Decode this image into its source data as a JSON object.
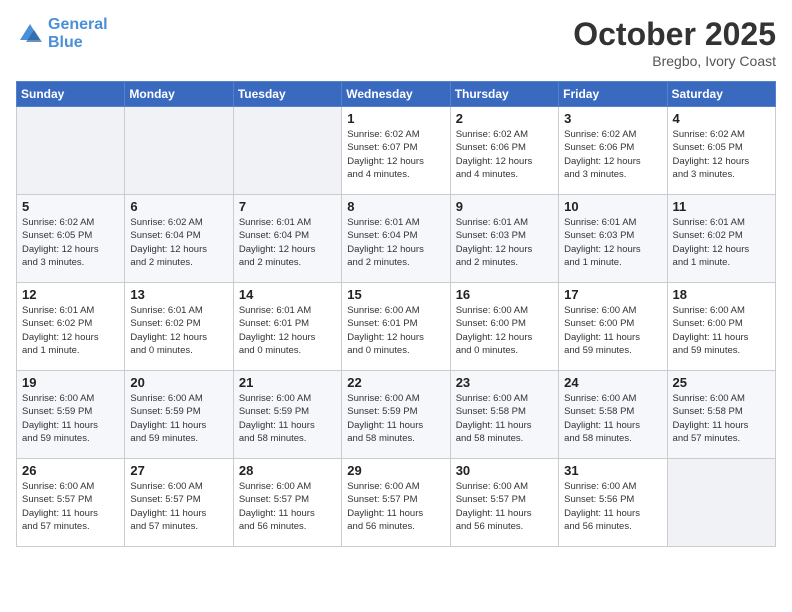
{
  "header": {
    "logo_line1": "General",
    "logo_line2": "Blue",
    "month": "October 2025",
    "location": "Bregbo, Ivory Coast"
  },
  "weekdays": [
    "Sunday",
    "Monday",
    "Tuesday",
    "Wednesday",
    "Thursday",
    "Friday",
    "Saturday"
  ],
  "weeks": [
    [
      {
        "day": "",
        "info": ""
      },
      {
        "day": "",
        "info": ""
      },
      {
        "day": "",
        "info": ""
      },
      {
        "day": "1",
        "info": "Sunrise: 6:02 AM\nSunset: 6:07 PM\nDaylight: 12 hours\nand 4 minutes."
      },
      {
        "day": "2",
        "info": "Sunrise: 6:02 AM\nSunset: 6:06 PM\nDaylight: 12 hours\nand 4 minutes."
      },
      {
        "day": "3",
        "info": "Sunrise: 6:02 AM\nSunset: 6:06 PM\nDaylight: 12 hours\nand 3 minutes."
      },
      {
        "day": "4",
        "info": "Sunrise: 6:02 AM\nSunset: 6:05 PM\nDaylight: 12 hours\nand 3 minutes."
      }
    ],
    [
      {
        "day": "5",
        "info": "Sunrise: 6:02 AM\nSunset: 6:05 PM\nDaylight: 12 hours\nand 3 minutes."
      },
      {
        "day": "6",
        "info": "Sunrise: 6:02 AM\nSunset: 6:04 PM\nDaylight: 12 hours\nand 2 minutes."
      },
      {
        "day": "7",
        "info": "Sunrise: 6:01 AM\nSunset: 6:04 PM\nDaylight: 12 hours\nand 2 minutes."
      },
      {
        "day": "8",
        "info": "Sunrise: 6:01 AM\nSunset: 6:04 PM\nDaylight: 12 hours\nand 2 minutes."
      },
      {
        "day": "9",
        "info": "Sunrise: 6:01 AM\nSunset: 6:03 PM\nDaylight: 12 hours\nand 2 minutes."
      },
      {
        "day": "10",
        "info": "Sunrise: 6:01 AM\nSunset: 6:03 PM\nDaylight: 12 hours\nand 1 minute."
      },
      {
        "day": "11",
        "info": "Sunrise: 6:01 AM\nSunset: 6:02 PM\nDaylight: 12 hours\nand 1 minute."
      }
    ],
    [
      {
        "day": "12",
        "info": "Sunrise: 6:01 AM\nSunset: 6:02 PM\nDaylight: 12 hours\nand 1 minute."
      },
      {
        "day": "13",
        "info": "Sunrise: 6:01 AM\nSunset: 6:02 PM\nDaylight: 12 hours\nand 0 minutes."
      },
      {
        "day": "14",
        "info": "Sunrise: 6:01 AM\nSunset: 6:01 PM\nDaylight: 12 hours\nand 0 minutes."
      },
      {
        "day": "15",
        "info": "Sunrise: 6:00 AM\nSunset: 6:01 PM\nDaylight: 12 hours\nand 0 minutes."
      },
      {
        "day": "16",
        "info": "Sunrise: 6:00 AM\nSunset: 6:00 PM\nDaylight: 12 hours\nand 0 minutes."
      },
      {
        "day": "17",
        "info": "Sunrise: 6:00 AM\nSunset: 6:00 PM\nDaylight: 11 hours\nand 59 minutes."
      },
      {
        "day": "18",
        "info": "Sunrise: 6:00 AM\nSunset: 6:00 PM\nDaylight: 11 hours\nand 59 minutes."
      }
    ],
    [
      {
        "day": "19",
        "info": "Sunrise: 6:00 AM\nSunset: 5:59 PM\nDaylight: 11 hours\nand 59 minutes."
      },
      {
        "day": "20",
        "info": "Sunrise: 6:00 AM\nSunset: 5:59 PM\nDaylight: 11 hours\nand 59 minutes."
      },
      {
        "day": "21",
        "info": "Sunrise: 6:00 AM\nSunset: 5:59 PM\nDaylight: 11 hours\nand 58 minutes."
      },
      {
        "day": "22",
        "info": "Sunrise: 6:00 AM\nSunset: 5:59 PM\nDaylight: 11 hours\nand 58 minutes."
      },
      {
        "day": "23",
        "info": "Sunrise: 6:00 AM\nSunset: 5:58 PM\nDaylight: 11 hours\nand 58 minutes."
      },
      {
        "day": "24",
        "info": "Sunrise: 6:00 AM\nSunset: 5:58 PM\nDaylight: 11 hours\nand 58 minutes."
      },
      {
        "day": "25",
        "info": "Sunrise: 6:00 AM\nSunset: 5:58 PM\nDaylight: 11 hours\nand 57 minutes."
      }
    ],
    [
      {
        "day": "26",
        "info": "Sunrise: 6:00 AM\nSunset: 5:57 PM\nDaylight: 11 hours\nand 57 minutes."
      },
      {
        "day": "27",
        "info": "Sunrise: 6:00 AM\nSunset: 5:57 PM\nDaylight: 11 hours\nand 57 minutes."
      },
      {
        "day": "28",
        "info": "Sunrise: 6:00 AM\nSunset: 5:57 PM\nDaylight: 11 hours\nand 56 minutes."
      },
      {
        "day": "29",
        "info": "Sunrise: 6:00 AM\nSunset: 5:57 PM\nDaylight: 11 hours\nand 56 minutes."
      },
      {
        "day": "30",
        "info": "Sunrise: 6:00 AM\nSunset: 5:57 PM\nDaylight: 11 hours\nand 56 minutes."
      },
      {
        "day": "31",
        "info": "Sunrise: 6:00 AM\nSunset: 5:56 PM\nDaylight: 11 hours\nand 56 minutes."
      },
      {
        "day": "",
        "info": ""
      }
    ]
  ]
}
